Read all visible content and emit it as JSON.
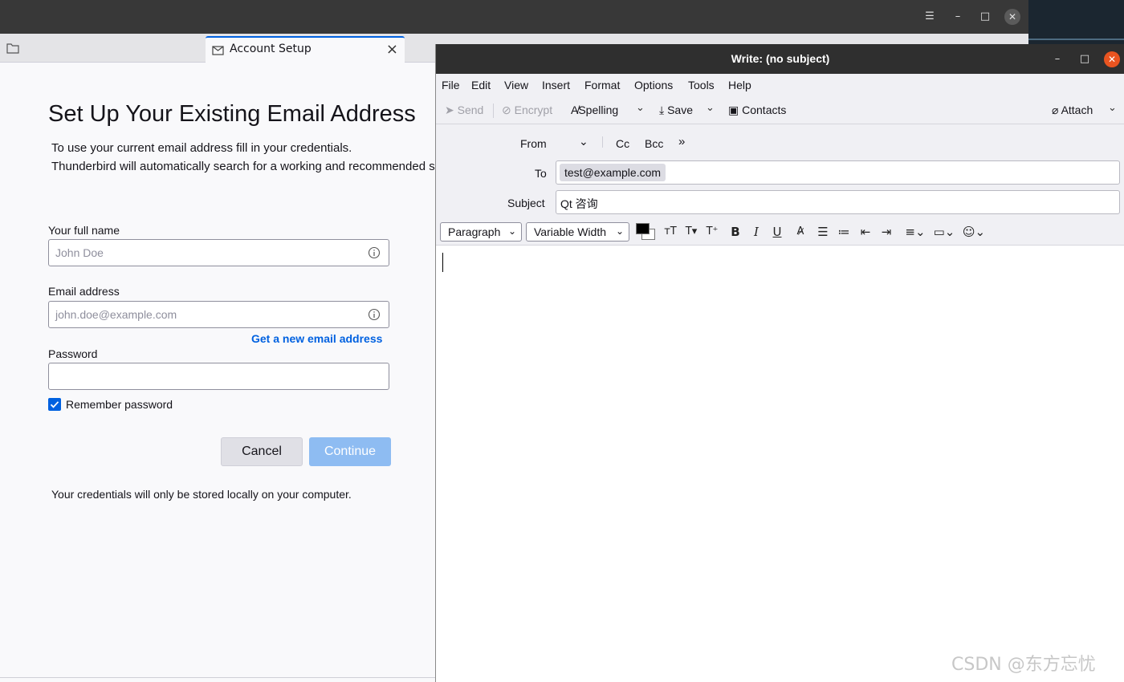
{
  "account_tab": {
    "label": "Account Setup"
  },
  "setup": {
    "title": "Set Up Your Existing Email Address",
    "desc_line1": "To use your current email address fill in your credentials.",
    "desc_line2": "Thunderbird will automatically search for a working and recommended server configuration.",
    "fullname": {
      "label": "Your full name",
      "placeholder": "John Doe"
    },
    "email": {
      "label": "Email address",
      "placeholder": "john.doe@example.com"
    },
    "new_email_link": "Get a new email address",
    "password": {
      "label": "Password",
      "value": ""
    },
    "remember": {
      "label": "Remember password",
      "checked": true
    },
    "cancel_label": "Cancel",
    "continue_label": "Continue",
    "local_note": "Your credentials will only be stored locally on your computer."
  },
  "compose": {
    "title": "Write: (no subject)",
    "menu": [
      "File",
      "Edit",
      "View",
      "Insert",
      "Format",
      "Options",
      "Tools",
      "Help"
    ],
    "toolbar": {
      "send": "Send",
      "encrypt": "Encrypt",
      "spelling": "Spelling",
      "save": "Save",
      "contacts": "Contacts",
      "attach": "Attach"
    },
    "headers": {
      "from_label": "From",
      "cc_label": "Cc",
      "bcc_label": "Bcc",
      "to_label": "To",
      "to_recipient": "test@example.com",
      "subject_label": "Subject",
      "subject_value": "Qt 咨询"
    },
    "format": {
      "paragraph": "Paragraph",
      "font": "Variable Width",
      "text_color": "#000000",
      "background_color": "#ffffff"
    }
  },
  "watermark": "CSDN @东方忘忧",
  "colors": {
    "accent": "#0061e0",
    "close_button": "#e95420",
    "continue_disabled": "#8ebcf2"
  }
}
